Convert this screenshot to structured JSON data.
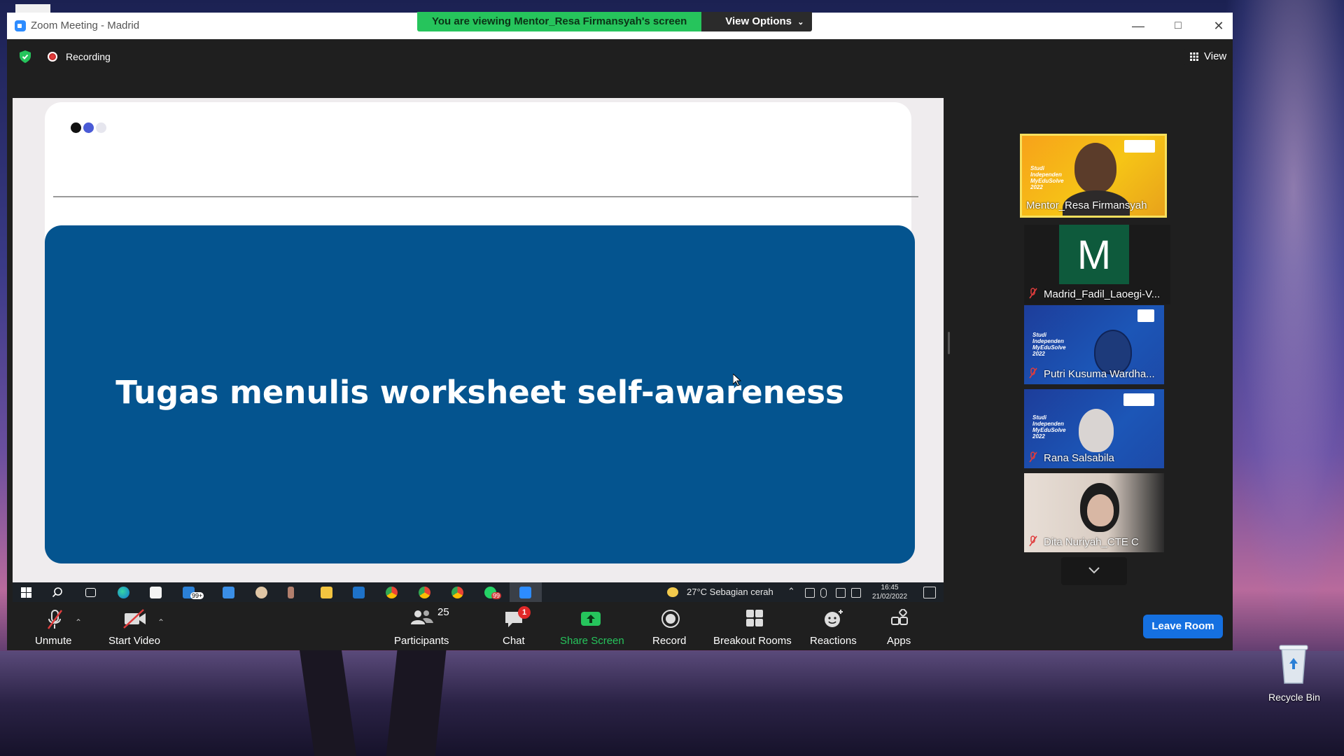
{
  "window": {
    "title": "Zoom Meeting - Madrid",
    "banner_text": "You are viewing Mentor_Resa Firmansyah's screen",
    "view_options_label": "View Options",
    "view_label": "View",
    "recording_label": "Recording"
  },
  "slide": {
    "title": "Tugas menulis worksheet self-awareness",
    "dot_colors": [
      "#111111",
      "#4a5bd6",
      "#e6e6ee"
    ]
  },
  "shared_taskbar": {
    "weather": "27°C  Sebagian cerah",
    "time": "16:45",
    "date": "21/02/2022",
    "mail_badge": "99+",
    "whatsapp_badge": "99"
  },
  "participants": [
    {
      "name": "Mentor_Resa Firmansyah",
      "muted": false,
      "active": true
    },
    {
      "name": "Madrid_Fadil_Laoegi-V...",
      "muted": true,
      "avatar_letter": "M"
    },
    {
      "name": "Putri Kusuma Wardha...",
      "muted": true
    },
    {
      "name": "Rana Salsabila",
      "muted": true
    },
    {
      "name": "Dita Nuriyah_CTE C",
      "muted": true
    }
  ],
  "camera_overlay_text": "Studi\nIndependen\nMyEduSolve\n2022",
  "toolbar": {
    "unmute": "Unmute",
    "start_video": "Start Video",
    "participants": "Participants",
    "participants_count": "25",
    "chat": "Chat",
    "chat_badge": "1",
    "share_screen": "Share Screen",
    "record": "Record",
    "breakout_rooms": "Breakout Rooms",
    "reactions": "Reactions",
    "apps": "Apps",
    "leave_room": "Leave Room"
  },
  "desktop": {
    "recycle_bin": "Recycle Bin"
  },
  "colors": {
    "banner_green": "#26c45c",
    "share_green": "#26c45c",
    "slide_blue": "#04548f",
    "leave_blue": "#1570e0",
    "active_border": "#f6e05e"
  }
}
